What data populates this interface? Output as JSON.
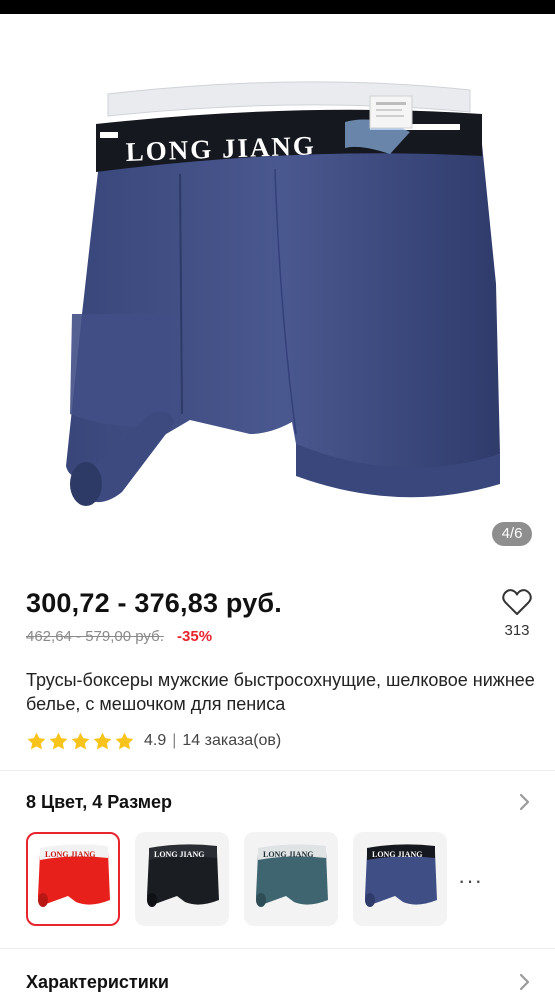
{
  "gallery": {
    "image_alt": "Boxer briefs product photo",
    "brand_print": "LONG JIANG",
    "page_indicator": "4/6"
  },
  "product": {
    "price_range": "300,72 - 376,83 руб.",
    "old_price_range": "462,64 - 579,00 руб.",
    "discount": "-35%",
    "title": "Трусы-боксеры мужские быстросохнущие, шелковое нижнее белье, с мешочком для пениса",
    "rating": "4.9",
    "rating_separator": "|",
    "orders": "14 заказа(ов)",
    "stars_filled": 5
  },
  "wishlist": {
    "icon": "heart-outline-icon",
    "count": "313"
  },
  "options": {
    "label": "8 Цвет, 4 Размер",
    "swatches": [
      {
        "color": "#e8201c",
        "name": "red",
        "selected": true
      },
      {
        "color": "#1a1d22",
        "name": "black",
        "selected": false
      },
      {
        "color": "#3e6570",
        "name": "teal",
        "selected": false
      },
      {
        "color": "#3f4f86",
        "name": "navy",
        "selected": false
      }
    ],
    "more": "···"
  },
  "specs": {
    "label": "Характеристики"
  },
  "colors": {
    "accent": "#e8242f",
    "star": "#f8c41c",
    "product_blue": "#45528a"
  }
}
